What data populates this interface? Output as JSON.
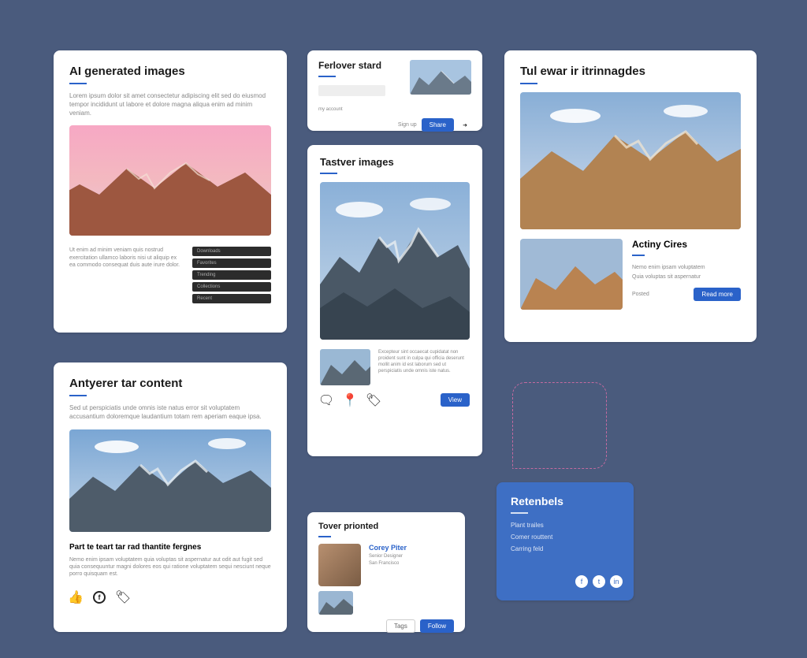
{
  "card1": {
    "title": "AI generated images",
    "blurb": "Lorem ipsum dolor sit amet consectetur adipiscing elit sed do eiusmod tempor incididunt ut labore et dolore magna aliqua enim ad minim veniam.",
    "lower_blurb": "Ut enim ad minim veniam quis nostrud exercitation ullamco laboris nisi ut aliquip ex ea commodo consequat duis aute irure dolor.",
    "bars": [
      "Downloads",
      "Favorites",
      "Trending",
      "Collections",
      "Recent"
    ]
  },
  "card2": {
    "title": "Ferlover stard",
    "meta": "my account",
    "link1": "Sign up",
    "cta": "Share"
  },
  "card3": {
    "title": "Tastver images",
    "sub_blurb": "Excepteur sint occaecat cupidatat non proident sunt in culpa qui officia deserunt mollit anim id est laborum sed ut perspiciatis unde omnis iste natus.",
    "cta": "View"
  },
  "card4": {
    "title": "Tul ewar ir itrinnagdes",
    "side_title": "Actiny Cires",
    "side_line1": "Nemo enim ipsam voluptatem",
    "side_line2": "Quia voluptas sit aspernatur",
    "side_foot": "Posted",
    "cta": "Read more"
  },
  "card5": {
    "title": "Antyerer tar content",
    "blurb": "Sed ut perspiciatis unde omnis iste natus error sit voluptatem accusantium doloremque laudantium totam rem aperiam eaque ipsa.",
    "subheading": "Part te teart tar rad thantite fergnes",
    "sub_blurb": "Nemo enim ipsam voluptatem quia voluptas sit aspernatur aut odit aut fugit sed quia consequuntur magni dolores eos qui ratione voluptatem sequi nesciunt neque porro quisquam est."
  },
  "card6": {
    "title": "Tover prionted",
    "name": "Corey Piter",
    "line1": "Senior Designer",
    "line2": "San Francisco",
    "cta": "Follow"
  },
  "card7": {
    "title": "Retenbels",
    "line1": "Plant trailes",
    "line2": "Comer routtent",
    "line3": "Carring feld"
  },
  "icons": {
    "thumbs": "thumbs-up-icon",
    "circle": "circle-f-icon",
    "tag": "tag-icon",
    "chat": "chat-icon",
    "pin": "pin-icon",
    "share": "share-icon"
  }
}
